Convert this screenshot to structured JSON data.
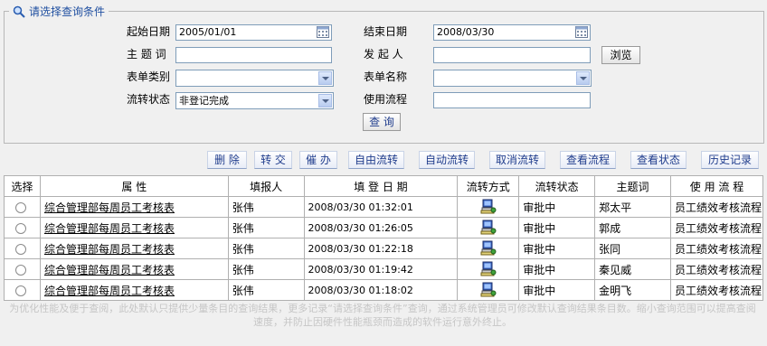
{
  "search": {
    "title": "请选择查询条件",
    "start_date_label": "起始日期",
    "start_date_value": "2005/01/01",
    "end_date_label": "结束日期",
    "end_date_value": "2008/03/30",
    "subject_label": "主 题 词",
    "subject_value": "",
    "initiator_label": "发 起 人",
    "initiator_value": "",
    "browse_label": "浏览",
    "form_type_label": "表单类别",
    "form_type_value": "",
    "form_name_label": "表单名称",
    "form_name_value": "",
    "status_label": "流转状态",
    "status_value": "非登记完成",
    "flow_label": "使用流程",
    "flow_value": "",
    "query_label": "查 询"
  },
  "toolbar": {
    "delete": "删 除",
    "transfer": "转 交",
    "remind": "催 办",
    "free_flow": "自由流转",
    "auto_flow": "自动流转",
    "cancel_flow": "取消流转",
    "view_flow": "查看流程",
    "view_status": "查看状态",
    "history": "历史记录"
  },
  "table": {
    "headers": [
      "选择",
      "属 性",
      "填报人",
      "填 登 日 期",
      "流转方式",
      "流转状态",
      "主题词",
      "使 用 流 程"
    ],
    "rows": [
      {
        "attr": "综合管理部每周员工考核表",
        "reporter": "张伟",
        "date": "2008/03/30 01:32:01",
        "status": "审批中",
        "subject": "郑太平",
        "flow": "员工绩效考核流程"
      },
      {
        "attr": "综合管理部每周员工考核表",
        "reporter": "张伟",
        "date": "2008/03/30 01:26:05",
        "status": "审批中",
        "subject": "郭成",
        "flow": "员工绩效考核流程"
      },
      {
        "attr": "综合管理部每周员工考核表",
        "reporter": "张伟",
        "date": "2008/03/30 01:22:18",
        "status": "审批中",
        "subject": "张同",
        "flow": "员工绩效考核流程"
      },
      {
        "attr": "综合管理部每周员工考核表",
        "reporter": "张伟",
        "date": "2008/03/30 01:19:42",
        "status": "审批中",
        "subject": "秦见威",
        "flow": "员工绩效考核流程"
      },
      {
        "attr": "综合管理部每周员工考核表",
        "reporter": "张伟",
        "date": "2008/03/30 01:18:02",
        "status": "审批中",
        "subject": "金明飞",
        "flow": "员工绩效考核流程"
      }
    ]
  },
  "note": "为优化性能及便于查阅，此处默认只提供少量条目的查询结果，更多记录“请选择查询条件”查询，通过系统管理员可修改默认查询结果条目数。缩小查询范围可以提高查阅速度，并防止因硬件性能瓶颈而造成的软件运行意外终止。",
  "icons": {
    "title_icon": "magnifier-icon",
    "calendar_icon": "calendar-icon",
    "flow_mode_icon": "workflow-computer-icon"
  }
}
